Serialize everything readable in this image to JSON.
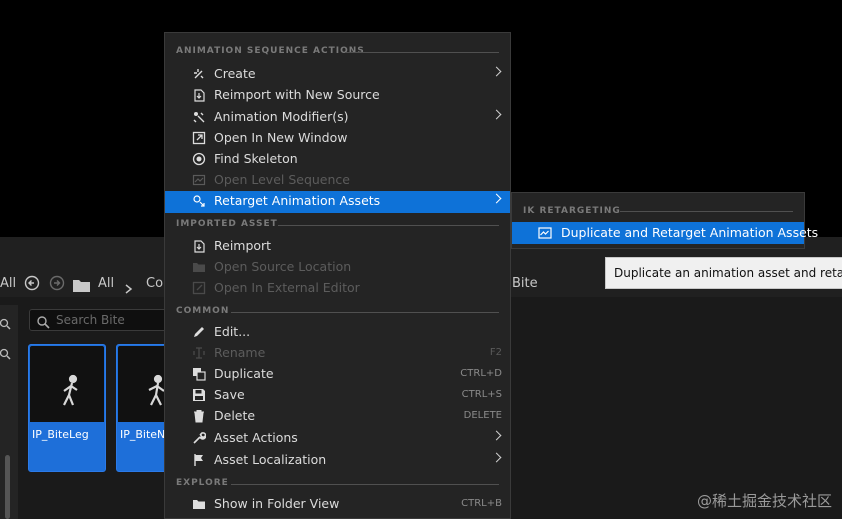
{
  "content_browser": {
    "nav": {
      "all_clip_label": "All",
      "all_label": "All",
      "path_clip": "Coi",
      "right_path": "Bite"
    },
    "search": {
      "placeholder": "Search Bite"
    },
    "assets": [
      {
        "name": "IP_BiteLeg"
      },
      {
        "name": "IP_BiteNe"
      }
    ]
  },
  "context_menu": {
    "sections": [
      {
        "header": "ANIMATION SEQUENCE ACTIONS",
        "items": [
          {
            "label": "Create",
            "icon": "create-icon",
            "enabled": true,
            "submenu": true
          },
          {
            "label": "Reimport with New Source",
            "icon": "reimport-icon",
            "enabled": true
          },
          {
            "label": "Animation Modifier(s)",
            "icon": "modifier-icon",
            "enabled": true,
            "submenu": true
          },
          {
            "label": "Open In New Window",
            "icon": "open-window-icon",
            "enabled": true
          },
          {
            "label": "Find Skeleton",
            "icon": "find-skeleton-icon",
            "enabled": true
          },
          {
            "label": "Open Level Sequence",
            "icon": "level-sequence-icon",
            "enabled": false
          },
          {
            "label": "Retarget Animation Assets",
            "icon": "retarget-icon",
            "enabled": true,
            "submenu": true,
            "highlighted": true
          }
        ]
      },
      {
        "header": "IMPORTED ASSET",
        "items": [
          {
            "label": "Reimport",
            "icon": "reimport-icon",
            "enabled": true
          },
          {
            "label": "Open Source Location",
            "icon": "folder-icon",
            "enabled": false
          },
          {
            "label": "Open In External Editor",
            "icon": "external-editor-icon",
            "enabled": false
          }
        ]
      },
      {
        "header": "COMMON",
        "items": [
          {
            "label": "Edit...",
            "icon": "edit-icon",
            "enabled": true
          },
          {
            "label": "Rename",
            "icon": "rename-icon",
            "enabled": false,
            "shortcut": "F2"
          },
          {
            "label": "Duplicate",
            "icon": "duplicate-icon",
            "enabled": true,
            "shortcut": "CTRL+D"
          },
          {
            "label": "Save",
            "icon": "save-icon",
            "enabled": true,
            "shortcut": "CTRL+S"
          },
          {
            "label": "Delete",
            "icon": "delete-icon",
            "enabled": true,
            "shortcut": "DELETE"
          },
          {
            "label": "Asset Actions",
            "icon": "wrench-icon",
            "enabled": true,
            "submenu": true
          },
          {
            "label": "Asset Localization",
            "icon": "flag-icon",
            "enabled": true,
            "submenu": true
          }
        ]
      },
      {
        "header": "EXPLORE",
        "items": [
          {
            "label": "Show in Folder View",
            "icon": "folder-icon",
            "enabled": true,
            "shortcut": "CTRL+B"
          }
        ]
      }
    ]
  },
  "submenu": {
    "header": "IK RETARGETING",
    "item": "Duplicate and Retarget Animation Assets"
  },
  "tooltip": "Duplicate an animation asset and retarget",
  "watermark": "@稀土掘金技术社区",
  "colors": {
    "highlight": "#0e72d8",
    "menu_bg": "#242424",
    "tile_selected": "#1e6fd9"
  }
}
